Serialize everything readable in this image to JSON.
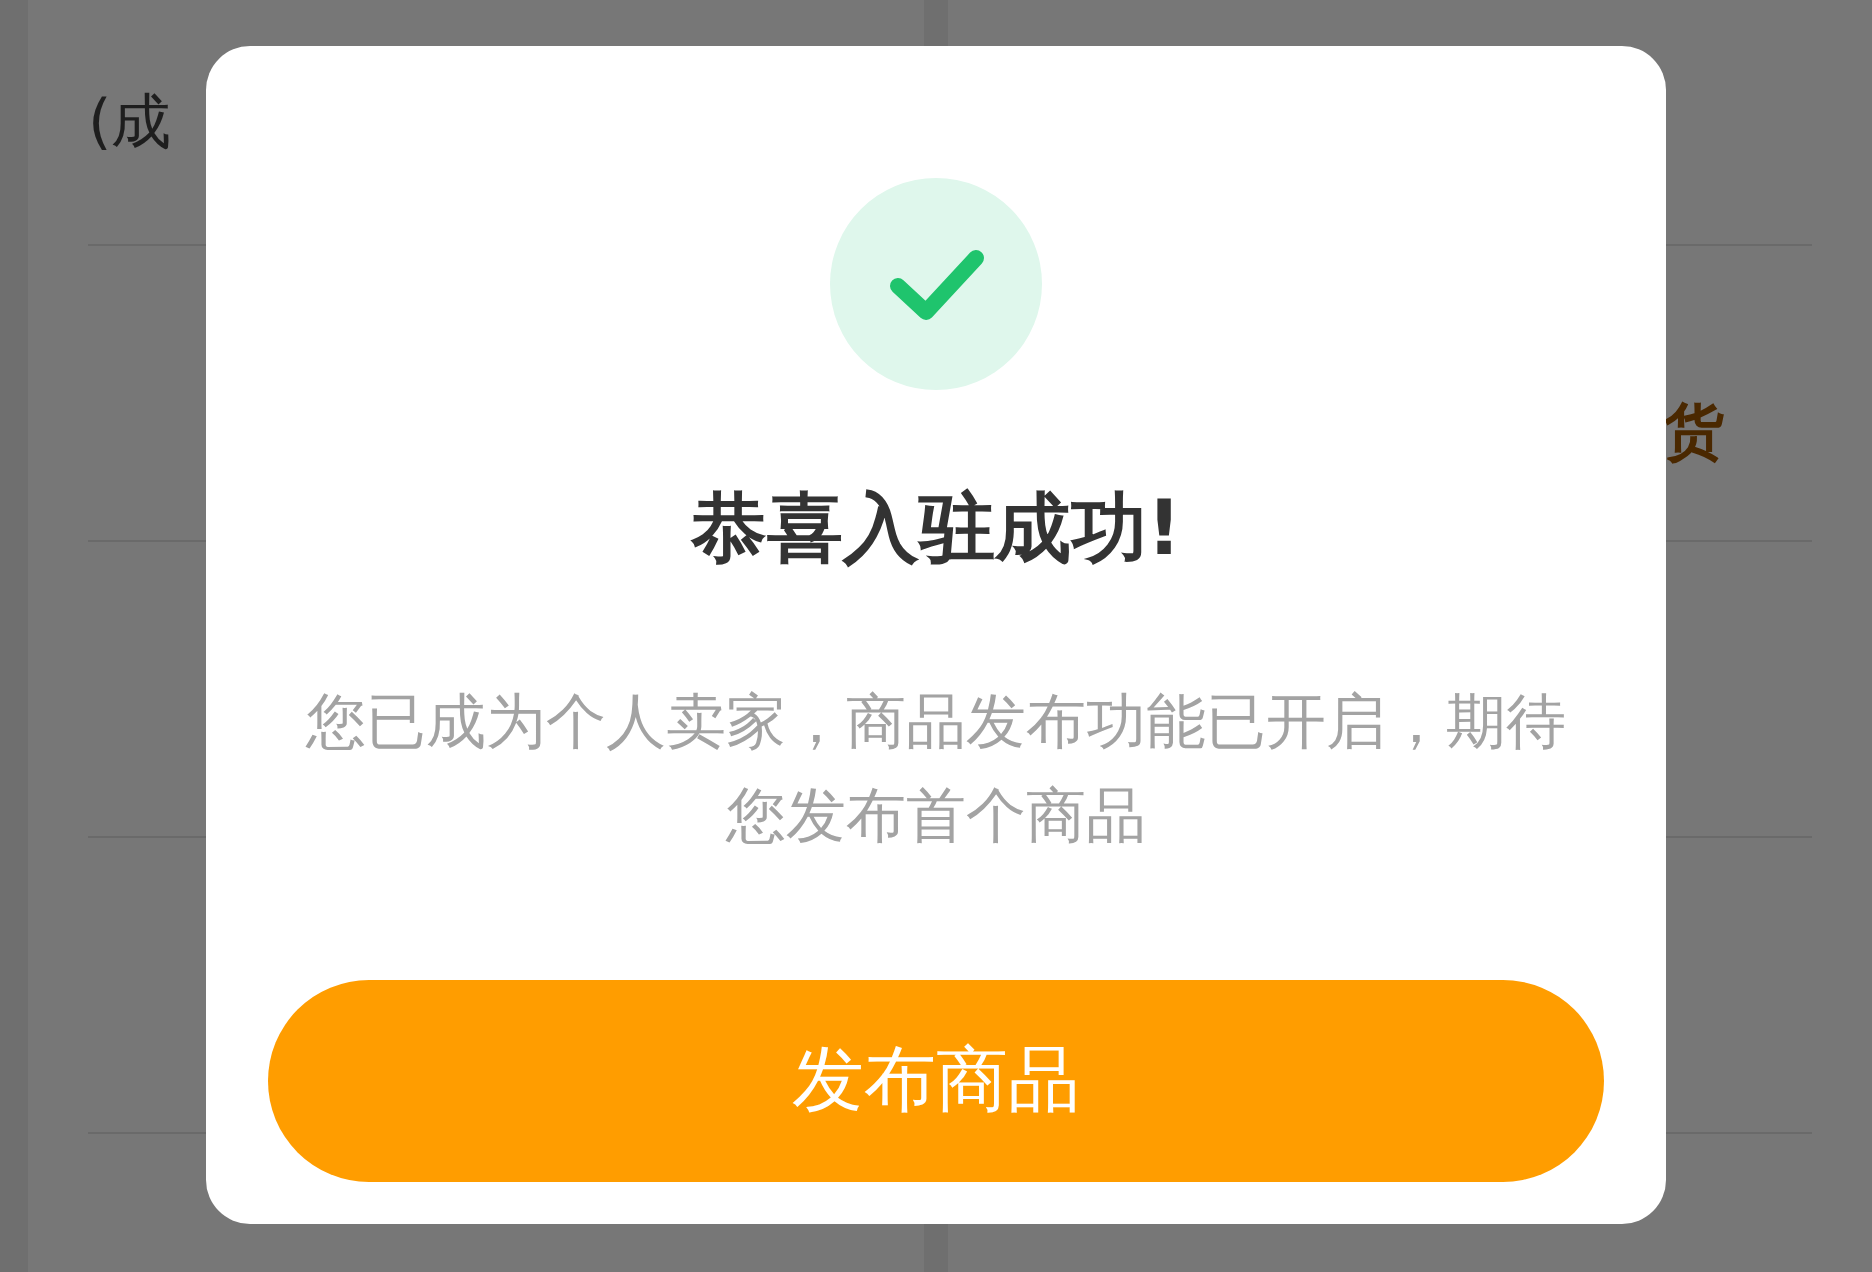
{
  "background": {
    "left_rows": [
      {
        "texts": [
          {
            "kind": "note",
            "text": "(成"
          }
        ]
      },
      {
        "texts": []
      },
      {
        "texts": []
      },
      {
        "texts": []
      },
      {
        "texts": []
      }
    ],
    "right_rows": [
      {
        "texts": []
      },
      {
        "texts": [
          {
            "kind": "highlight",
            "text": "货"
          }
        ]
      },
      {
        "texts": []
      },
      {
        "texts": []
      },
      {
        "texts": []
      }
    ]
  },
  "dialog": {
    "title": "恭喜入驻成功!",
    "message": "您已成为个人卖家，商品发布功能已开启，期待您发布首个商品",
    "button": "发布商品"
  }
}
